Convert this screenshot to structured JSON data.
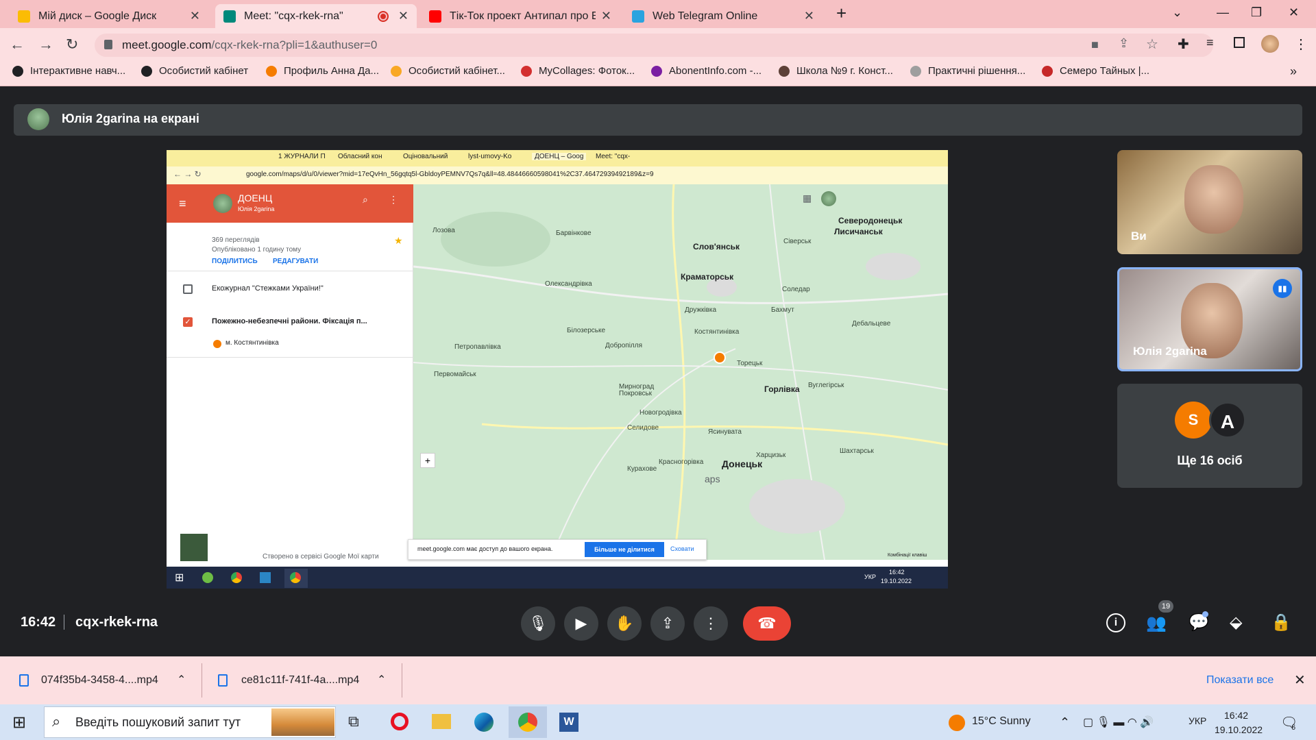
{
  "browser": {
    "tabs": [
      {
        "title": "Мій диск – Google Диск",
        "icon": "google-drive-icon",
        "color": "#fbbc04"
      },
      {
        "title": "Meet: \"cqx-rkek-rna\"",
        "icon": "google-meet-icon",
        "color": "#00897b",
        "active": true,
        "recording": true
      },
      {
        "title": "Тік-Ток проект Антипал про Ек",
        "icon": "youtube-icon",
        "color": "#ff0000"
      },
      {
        "title": "Web Telegram Online",
        "icon": "telegram-icon",
        "color": "#2aa3df"
      }
    ],
    "new_tab": "+",
    "url_host": "meet.google.com",
    "url_path": "/cqx-rkek-rna?pli=1&authuser=0",
    "bookmarks": [
      {
        "label": "Інтерактивне навч...",
        "color": "#202124"
      },
      {
        "label": "Особистий кабінет",
        "color": "#202124"
      },
      {
        "label": "Профиль Анна Да...",
        "color": "#f57c00"
      },
      {
        "label": "Особистий кабінет...",
        "color": "#f9a825"
      },
      {
        "label": "MyCollages: Фоток...",
        "color": "#d32f2f"
      },
      {
        "label": "AbonentInfo.com -...",
        "color": "#7b1fa2"
      },
      {
        "label": "Школа №9 г. Конст...",
        "color": "#5d4037"
      },
      {
        "label": "Практичні рішення...",
        "color": "#9e9e9e"
      },
      {
        "label": "Семеро Тайных |...",
        "color": "#c62828"
      }
    ],
    "bookmarks_more": "»"
  },
  "meet": {
    "presenter_banner": "Юлія 2garina на екрані",
    "time": "16:42",
    "meeting_code": "cqx-rkek-rna",
    "participants_count": "19",
    "tiles": [
      {
        "name": "Ви"
      },
      {
        "name": "Юлія 2garina"
      },
      {
        "name": "Ще 16 осіб",
        "avatars": [
          "S",
          "A"
        ]
      }
    ]
  },
  "shared": {
    "tabs": [
      "1 ЖУРНАЛИ П",
      "Обласний кон",
      "Оціновальний",
      "lyst-umovy-Ko",
      "ДОЕНЦ – Goog",
      "Meet: \"cqx-"
    ],
    "url": "google.com/maps/d/u/0/viewer?mid=17eQvHn_56gqtq5l-GbldoyPEMNV7Qs7q&ll=48.48446660598041%2C37.46472939492189&z=9",
    "map_title": "ДОЕНЦ",
    "map_owner": "Юлія 2garina",
    "views": "369 переглядів",
    "published": "Опубліковано 1 годину тому",
    "share_link": "ПОДІЛИТИСЬ",
    "edit_link": "РЕДАГУВАТИ",
    "layers": [
      {
        "label": "Екожурнал \"Стежками України!\"",
        "checked": false
      },
      {
        "label": "Пожежно-небезпечні райони. Фіксація п...",
        "checked": true
      }
    ],
    "place": "м. Костянтинівка",
    "footer_credit": "Створено в сервісі Google Мої карти",
    "share_notice": "meet.google.com має доступ до вашого екрана.",
    "stop_sharing": "Більше не ділитися",
    "hide": "Сховати",
    "maps_wordmark": "aps",
    "keyboard": "Комбінації клавіш",
    "map_cities": [
      {
        "name": "Слов'янськ",
        "cls": "big"
      },
      {
        "name": "Краматорськ",
        "cls": "big"
      },
      {
        "name": "Горлівка",
        "cls": "big"
      },
      {
        "name": "Донецьк",
        "cls": "huge"
      },
      {
        "name": "Северодонецьк",
        "cls": "big"
      },
      {
        "name": "Лисичанськ",
        "cls": "big"
      },
      {
        "name": "Костянтинівка",
        "cls": ""
      },
      {
        "name": "Дружківка",
        "cls": ""
      },
      {
        "name": "Бахмут",
        "cls": ""
      },
      {
        "name": "Добропілля",
        "cls": ""
      },
      {
        "name": "Покровськ",
        "cls": ""
      },
      {
        "name": "Олександрівка",
        "cls": ""
      },
      {
        "name": "Барвінкове",
        "cls": ""
      },
      {
        "name": "Лозова",
        "cls": ""
      },
      {
        "name": "Петропавлівка",
        "cls": ""
      },
      {
        "name": "Первомайськ",
        "cls": ""
      },
      {
        "name": "Новогродівка",
        "cls": ""
      },
      {
        "name": "Торецьк",
        "cls": ""
      },
      {
        "name": "Ясинувата",
        "cls": ""
      },
      {
        "name": "Харцизьк",
        "cls": ""
      },
      {
        "name": "Вуглегірськ",
        "cls": ""
      },
      {
        "name": "Дебальцеве",
        "cls": ""
      },
      {
        "name": "Сіверськ",
        "cls": ""
      },
      {
        "name": "Соледар",
        "cls": ""
      },
      {
        "name": "Білозерське",
        "cls": ""
      },
      {
        "name": "Шахтарськ",
        "cls": ""
      },
      {
        "name": "Кураxове",
        "cls": ""
      },
      {
        "name": "Селидове",
        "cls": ""
      },
      {
        "name": "Мирноград",
        "cls": ""
      },
      {
        "name": "Красногорівка",
        "cls": ""
      }
    ],
    "taskbar_time": "16:42",
    "taskbar_date": "19.10.2022",
    "taskbar_lang": "УКР"
  },
  "downloads": {
    "items": [
      "074f35b4-3458-4....mp4",
      "ce81c11f-741f-4a....mp4"
    ],
    "show_all": "Показати все"
  },
  "taskbar": {
    "search_placeholder": "Введіть пошуковий запит тут",
    "weather": "15°C  Sunny",
    "lang": "УКР",
    "time": "16:42",
    "date": "19.10.2022",
    "notifications": "6"
  }
}
